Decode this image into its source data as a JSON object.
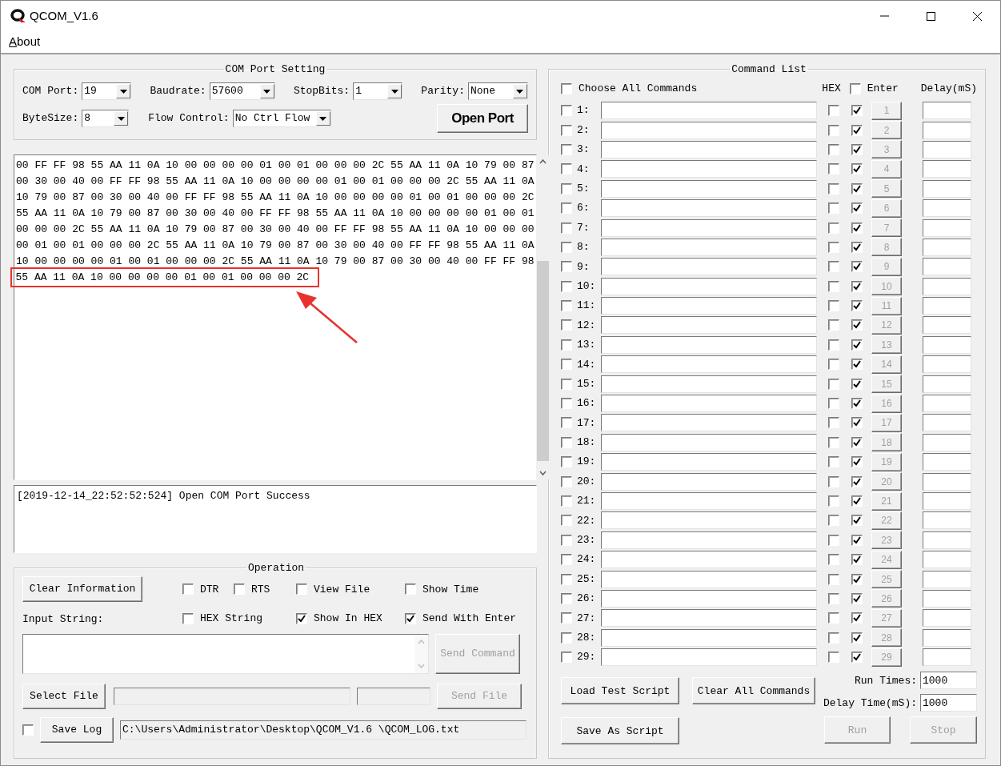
{
  "window": {
    "title": "QCOM_V1.6"
  },
  "menu": [
    {
      "label": "About"
    }
  ],
  "com_port_setting": {
    "title": "COM Port Setting",
    "fields": [
      {
        "label": "COM Port:",
        "value": "19"
      },
      {
        "label": "Baudrate:",
        "value": "57600"
      },
      {
        "label": "StopBits:",
        "value": "1"
      },
      {
        "label": "Parity:",
        "value": "None"
      },
      {
        "label": "ByteSize:",
        "value": "8"
      },
      {
        "label": "Flow Control:",
        "value": "No Ctrl Flow"
      }
    ],
    "open_port_button": "Open Port"
  },
  "receive_lines": [
    "00 FF FF 98 55 AA 11 0A 10 00 00 00 00 01 00 01 00 00 00 2C 55 AA 11 0A 10 79 00 87",
    "00 30 00 40 00 FF FF 98 55 AA 11 0A 10 00 00 00 00 01 00 01 00 00 00 2C 55 AA 11 0A",
    "10 79 00 87 00 30 00 40 00 FF FF 98 55 AA 11 0A 10 00 00 00 00 01 00 01 00 00 00 2C",
    "55 AA 11 0A 10 79 00 87 00 30 00 40 00 FF FF 98 55 AA 11 0A 10 00 00 00 00 01 00 01",
    "00 00 00 2C 55 AA 11 0A 10 79 00 87 00 30 00 40 00 FF FF 98 55 AA 11 0A 10 00 00 00",
    "00 01 00 01 00 00 00 2C 55 AA 11 0A 10 79 00 87 00 30 00 40 00 FF FF 98 55 AA 11 0A",
    "10 00 00 00 00 01 00 01 00 00 00 2C 55 AA 11 0A 10 79 00 87 00 30 00 40 00 FF FF 98",
    "55 AA 11 0A 10 00 00 00 00 01 00 01 00 00 00 2C"
  ],
  "log_lines": [
    "[2019-12-14_22:52:52:524] Open COM Port Success"
  ],
  "operation": {
    "title": "Operation",
    "clear_button": {
      "label": "Clear Information",
      "disabled": false
    },
    "options": [
      {
        "label": "DTR",
        "checked": false
      },
      {
        "label": "RTS",
        "checked": false
      },
      {
        "label": "View File",
        "checked": false
      },
      {
        "label": "Show Time",
        "checked": false
      },
      {
        "label": "HEX String",
        "checked": false
      },
      {
        "label": "Show In HEX",
        "checked": true
      },
      {
        "label": "Send With Enter",
        "checked": true
      }
    ],
    "input_label": "Input String:",
    "send_command_button": {
      "label": "Send Command",
      "disabled": true
    },
    "select_file_button": {
      "label": "Select File",
      "disabled": false
    },
    "send_file_button": {
      "label": "Send File",
      "disabled": true
    },
    "save_log_checked": false,
    "save_log_button": {
      "label": "Save Log",
      "disabled": false
    },
    "log_path": "C:\\Users\\Administrator\\Desktop\\QCOM_V1.6 \\QCOM_LOG.txt"
  },
  "command_list": {
    "title": "Command List",
    "choose_all": {
      "label": "Choose All Commands",
      "checked": false
    },
    "hex_header": "HEX",
    "enter_header": {
      "label": "Enter",
      "checked": false
    },
    "delay_header": "Delay(mS)",
    "rows": [
      {
        "checked": false,
        "label": "1:",
        "hex": false,
        "enter": true,
        "button": "1",
        "disabled": true
      },
      {
        "checked": false,
        "label": "2:",
        "hex": false,
        "enter": true,
        "button": "2",
        "disabled": true
      },
      {
        "checked": false,
        "label": "3:",
        "hex": false,
        "enter": true,
        "button": "3",
        "disabled": true
      },
      {
        "checked": false,
        "label": "4:",
        "hex": false,
        "enter": true,
        "button": "4",
        "disabled": true
      },
      {
        "checked": false,
        "label": "5:",
        "hex": false,
        "enter": true,
        "button": "5",
        "disabled": true
      },
      {
        "checked": false,
        "label": "6:",
        "hex": false,
        "enter": true,
        "button": "6",
        "disabled": true
      },
      {
        "checked": false,
        "label": "7:",
        "hex": false,
        "enter": true,
        "button": "7",
        "disabled": true
      },
      {
        "checked": false,
        "label": "8:",
        "hex": false,
        "enter": true,
        "button": "8",
        "disabled": true
      },
      {
        "checked": false,
        "label": "9:",
        "hex": false,
        "enter": true,
        "button": "9",
        "disabled": true
      },
      {
        "checked": false,
        "label": "10:",
        "hex": false,
        "enter": true,
        "button": "10",
        "disabled": true
      },
      {
        "checked": false,
        "label": "11:",
        "hex": false,
        "enter": true,
        "button": "11",
        "disabled": true
      },
      {
        "checked": false,
        "label": "12:",
        "hex": false,
        "enter": true,
        "button": "12",
        "disabled": true
      },
      {
        "checked": false,
        "label": "13:",
        "hex": false,
        "enter": true,
        "button": "13",
        "disabled": true
      },
      {
        "checked": false,
        "label": "14:",
        "hex": false,
        "enter": true,
        "button": "14",
        "disabled": true
      },
      {
        "checked": false,
        "label": "15:",
        "hex": false,
        "enter": true,
        "button": "15",
        "disabled": true
      },
      {
        "checked": false,
        "label": "16:",
        "hex": false,
        "enter": true,
        "button": "16",
        "disabled": true
      },
      {
        "checked": false,
        "label": "17:",
        "hex": false,
        "enter": true,
        "button": "17",
        "disabled": true
      },
      {
        "checked": false,
        "label": "18:",
        "hex": false,
        "enter": true,
        "button": "18",
        "disabled": true
      },
      {
        "checked": false,
        "label": "19:",
        "hex": false,
        "enter": true,
        "button": "19",
        "disabled": true
      },
      {
        "checked": false,
        "label": "20:",
        "hex": false,
        "enter": true,
        "button": "20",
        "disabled": true
      },
      {
        "checked": false,
        "label": "21:",
        "hex": false,
        "enter": true,
        "button": "21",
        "disabled": true
      },
      {
        "checked": false,
        "label": "22:",
        "hex": false,
        "enter": true,
        "button": "22",
        "disabled": true
      },
      {
        "checked": false,
        "label": "23:",
        "hex": false,
        "enter": true,
        "button": "23",
        "disabled": true
      },
      {
        "checked": false,
        "label": "24:",
        "hex": false,
        "enter": true,
        "button": "24",
        "disabled": true
      },
      {
        "checked": false,
        "label": "25:",
        "hex": false,
        "enter": true,
        "button": "25",
        "disabled": true
      },
      {
        "checked": false,
        "label": "26:",
        "hex": false,
        "enter": true,
        "button": "26",
        "disabled": true
      },
      {
        "checked": false,
        "label": "27:",
        "hex": false,
        "enter": true,
        "button": "27",
        "disabled": true
      },
      {
        "checked": false,
        "label": "28:",
        "hex": false,
        "enter": true,
        "button": "28",
        "disabled": true
      },
      {
        "checked": false,
        "label": "29:",
        "hex": false,
        "enter": true,
        "button": "29",
        "disabled": true
      }
    ],
    "load_button": {
      "label": "Load Test Script",
      "disabled": false
    },
    "clear_button": {
      "label": "Clear All Commands",
      "disabled": false
    },
    "run_times": {
      "label": "Run Times:",
      "value": "1000"
    },
    "delay_time": {
      "label": "Delay Time(mS):",
      "value": "1000"
    },
    "save_button": {
      "label": "Save As Script",
      "disabled": false
    },
    "run_button": {
      "label": "Run",
      "disabled": true
    },
    "stop_button": {
      "label": "Stop",
      "disabled": true
    }
  }
}
